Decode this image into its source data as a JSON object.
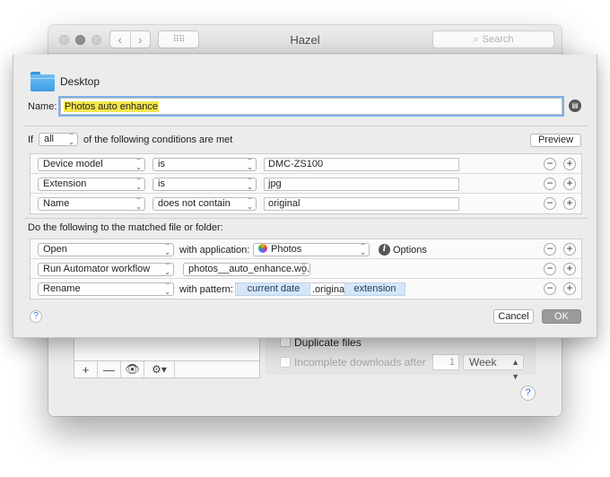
{
  "window": {
    "title": "Hazel",
    "search_placeholder": "Search",
    "nav_back_icon": "chevron-left-icon",
    "nav_forward_icon": "chevron-right-icon"
  },
  "background": {
    "toolbar": {
      "add": "+",
      "remove": "—",
      "eye_icon": "eye-icon",
      "gear_icon": "gear-icon"
    },
    "duplicate_files_label": "Duplicate files",
    "incomplete_downloads_label": "Incomplete downloads after",
    "incomplete_downloads_value": "1",
    "incomplete_downloads_unit": "Week",
    "help": "?"
  },
  "sheet": {
    "folder_name": "Desktop",
    "name_label": "Name:",
    "rule_name": "Photos auto enhance",
    "if_label": "If",
    "match_mode": "all",
    "conditions_label": "of the following conditions are met",
    "preview_button": "Preview",
    "conditions": [
      {
        "attribute": "Device model",
        "operator": "is",
        "value": "DMC-ZS100"
      },
      {
        "attribute": "Extension",
        "operator": "is",
        "value": "jpg"
      },
      {
        "attribute": "Name",
        "operator": "does not contain",
        "value": "original"
      }
    ],
    "actions_label": "Do the following to the matched file or folder:",
    "actions": {
      "open": {
        "action": "Open",
        "with_label": "with application:",
        "app": "Photos",
        "options_label": "Options"
      },
      "automator": {
        "action": "Run Automator workflow",
        "workflow": "photos__auto_enhance.wo..."
      },
      "rename": {
        "action": "Rename",
        "with_label": "with pattern:",
        "token1": "current date",
        "literal": ".original",
        "token2": "extension"
      }
    },
    "minus": "−",
    "plus": "+",
    "help": "?",
    "cancel_button": "Cancel",
    "ok_button": "OK"
  }
}
